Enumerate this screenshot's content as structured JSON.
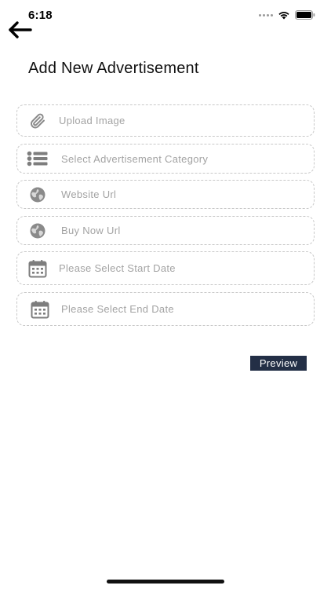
{
  "status_bar": {
    "time": "6:18"
  },
  "header": {
    "title": "Add New Advertisement"
  },
  "form": {
    "fields": [
      {
        "label": "Upload Image",
        "icon": "paperclip-icon"
      },
      {
        "label": "Select Advertisement Category",
        "icon": "list-icon"
      },
      {
        "label": "Website Url",
        "icon": "globe-icon"
      },
      {
        "label": "Buy Now Url",
        "icon": "globe-icon"
      },
      {
        "label": "Please Select Start  Date",
        "icon": "calendar-icon"
      },
      {
        "label": "Please Select End  Date",
        "icon": "calendar-icon"
      }
    ],
    "preview_label": "Preview"
  },
  "colors": {
    "button_bg": "#232f46",
    "placeholder": "#a3a3a3",
    "border": "#c8c8c8",
    "icon": "#8a8a8a"
  }
}
